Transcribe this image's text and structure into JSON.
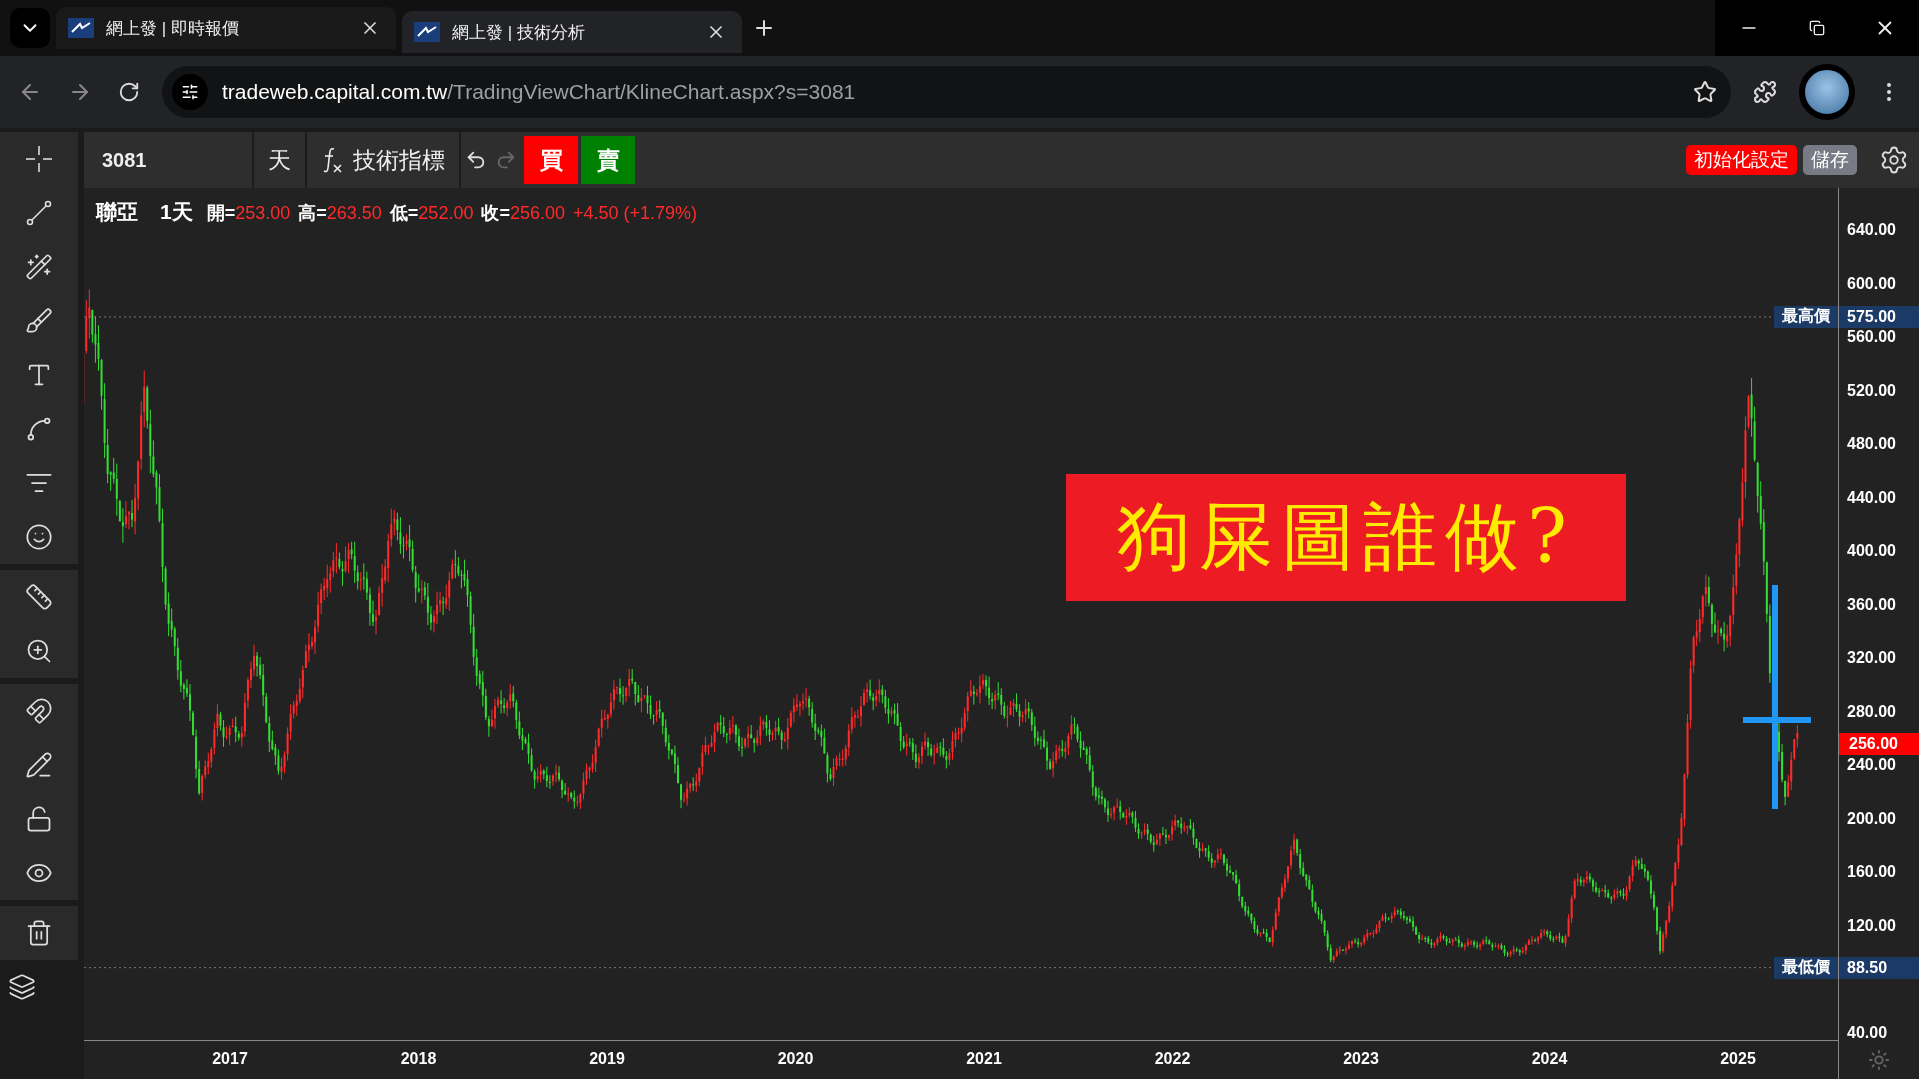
{
  "browser": {
    "tabs": [
      {
        "title": "網上發 | 即時報價",
        "selected": false
      },
      {
        "title": "網上發 | 技術分析",
        "selected": true
      }
    ],
    "address": {
      "host": "tradeweb.capital.com.tw",
      "path": "/TradingViewChart/KlineChart.aspx?s=3081"
    }
  },
  "toolbar": {
    "symbol": "3081",
    "interval": "天",
    "indicators": "技術指標",
    "redo_disabled": true,
    "buy": "買",
    "sell": "賣",
    "reset": "初始化設定",
    "save": "儲存"
  },
  "legend": {
    "name": "聯亞",
    "interval": "1天",
    "fields": [
      {
        "label": "開=",
        "value": "253.00"
      },
      {
        "label": "高=",
        "value": "263.50"
      },
      {
        "label": "低=",
        "value": "252.00"
      },
      {
        "label": "收=",
        "value": "256.00"
      }
    ],
    "change": "+4.50 (+1.79%)"
  },
  "overlay": {
    "text": "狗屎圖誰做?"
  },
  "price_axis": {
    "ticks": [
      "640.00",
      "600.00",
      "560.00",
      "520.00",
      "480.00",
      "440.00",
      "400.00",
      "360.00",
      "320.00",
      "280.00",
      "240.00",
      "200.00",
      "160.00",
      "120.00",
      "40.00"
    ],
    "high": {
      "label": "最高價",
      "value": "575.00"
    },
    "low": {
      "label": "最低價",
      "value": "88.50"
    },
    "last": "256.00"
  },
  "time_axis": {
    "ticks": [
      "2017",
      "2018",
      "2019",
      "2020",
      "2021",
      "2022",
      "2023",
      "2024",
      "2025"
    ]
  }
}
